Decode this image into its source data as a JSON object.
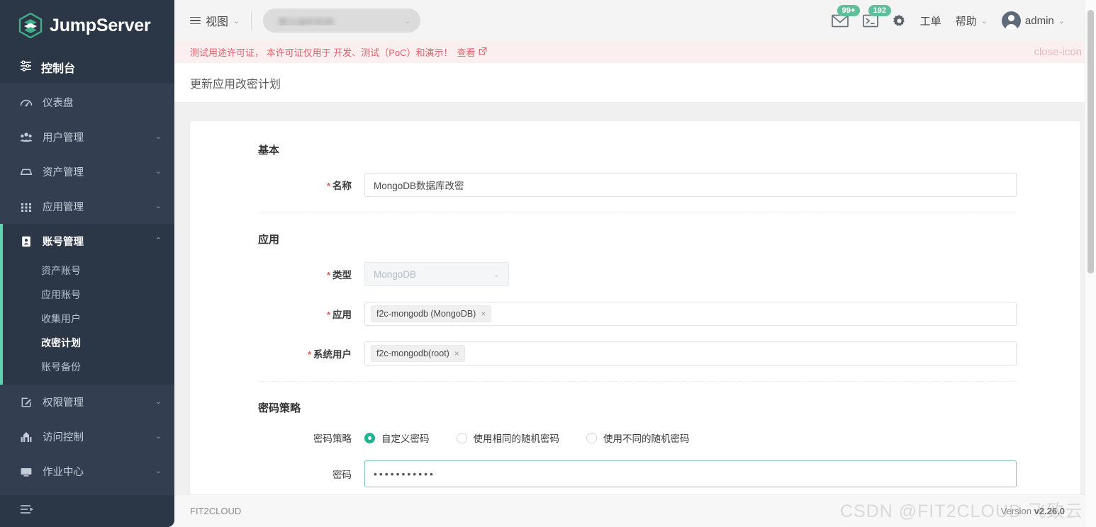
{
  "brand": {
    "name": "JumpServer",
    "logo_icon": "jumpserver-logo-icon"
  },
  "sidebar": {
    "console_label": "控制台",
    "console_icon": "sliders-icon",
    "collapse_icon": "collapse-menu-icon",
    "items": [
      {
        "label": "仪表盘",
        "icon": "dashboard-icon",
        "arrow": "",
        "expanded": false
      },
      {
        "label": "用户管理",
        "icon": "users-icon",
        "arrow": "⌄",
        "expanded": false
      },
      {
        "label": "资产管理",
        "icon": "inbox-icon",
        "arrow": "⌄",
        "expanded": false
      },
      {
        "label": "应用管理",
        "icon": "grid-icon",
        "arrow": "⌄",
        "expanded": false
      },
      {
        "label": "账号管理",
        "icon": "contact-card-icon",
        "arrow": "⌃",
        "expanded": true
      }
    ],
    "submenu": [
      {
        "label": "资产账号",
        "active": false
      },
      {
        "label": "应用账号",
        "active": false
      },
      {
        "label": "收集用户",
        "active": false
      },
      {
        "label": "改密计划",
        "active": true
      },
      {
        "label": "账号备份",
        "active": false
      }
    ],
    "items_after": [
      {
        "label": "权限管理",
        "icon": "edit-square-icon",
        "arrow": "⌄"
      },
      {
        "label": "访问控制",
        "icon": "gate-icon",
        "arrow": "⌄"
      },
      {
        "label": "作业中心",
        "icon": "terminal-screen-icon",
        "arrow": "⌄"
      }
    ]
  },
  "topbar": {
    "view_label": "视图",
    "view_icon": "hamburger-icon",
    "view_caret": "⌄",
    "org_selected": "默认组织机构",
    "org_caret": "⌄",
    "mail_icon": "envelope-icon",
    "mail_badge": "99+",
    "terminal_icon": "terminal-icon",
    "terminal_badge": "192",
    "gear_icon": "gear-icon",
    "ticket_label": "工单",
    "help_label": "帮助",
    "help_caret": "⌄",
    "user_name": "admin",
    "user_caret": "⌄",
    "avatar_icon": "avatar-icon"
  },
  "license": {
    "text": "测试用途许可证，  本许可证仅用于 开发、测试（PoC）和演示！",
    "link_label": "查看",
    "link_icon": "external-link-icon",
    "close_icon": "close-icon",
    "color": "#e4606d",
    "background": "#fcefef"
  },
  "page": {
    "title": "更新应用改密计划"
  },
  "form": {
    "section_basic": "基本",
    "name_label": "名称",
    "name_value": "MongoDB数据库改密",
    "section_app": "应用",
    "type_label": "类型",
    "type_value": "MongoDB",
    "type_caret": "⌄",
    "app_label": "应用",
    "app_tag": "f2c-mongodb (MongoDB)",
    "app_tag_remove": "×",
    "sysuser_label": "系统用户",
    "sysuser_tag": "f2c-mongodb(root)",
    "sysuser_tag_remove": "×",
    "section_policy": "密码策略",
    "policy_label": "密码策略",
    "policy_options": [
      {
        "label": "自定义密码",
        "checked": true
      },
      {
        "label": "使用相同的随机密码",
        "checked": false
      },
      {
        "label": "使用不同的随机密码",
        "checked": false
      }
    ],
    "password_label": "密码",
    "password_value": "•••••••••••",
    "required_marker": "*",
    "accent_color": "#1fb392"
  },
  "footer": {
    "left_label": "FIT2CLOUD",
    "version_prefix": "Version ",
    "version_value": "v2.26.0"
  },
  "watermark": {
    "text": "CSDN @FIT2CLOUD 飞致云"
  }
}
